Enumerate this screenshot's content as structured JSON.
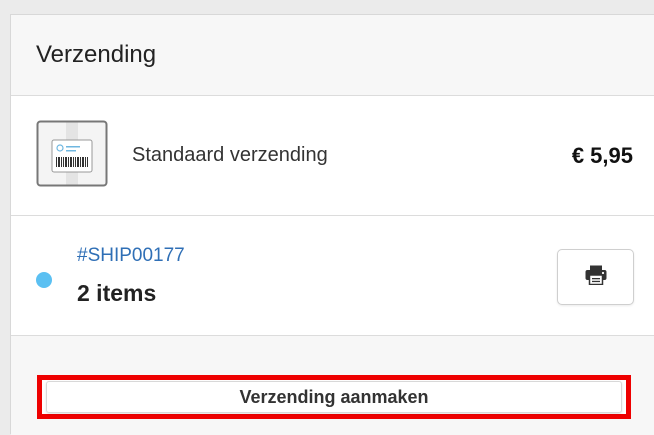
{
  "header": {
    "title": "Verzending"
  },
  "method": {
    "label": "Standaard verzending",
    "price": "€ 5,95",
    "icon": "package-label-icon"
  },
  "shipment": {
    "id": "#SHIP00177",
    "items": "2 items",
    "status_color": "#5bc0f2",
    "print_icon": "printer-icon"
  },
  "actions": {
    "create_label": "Verzending aanmaken"
  },
  "colors": {
    "link": "#2f6fb6",
    "highlight": "#ee0000"
  }
}
